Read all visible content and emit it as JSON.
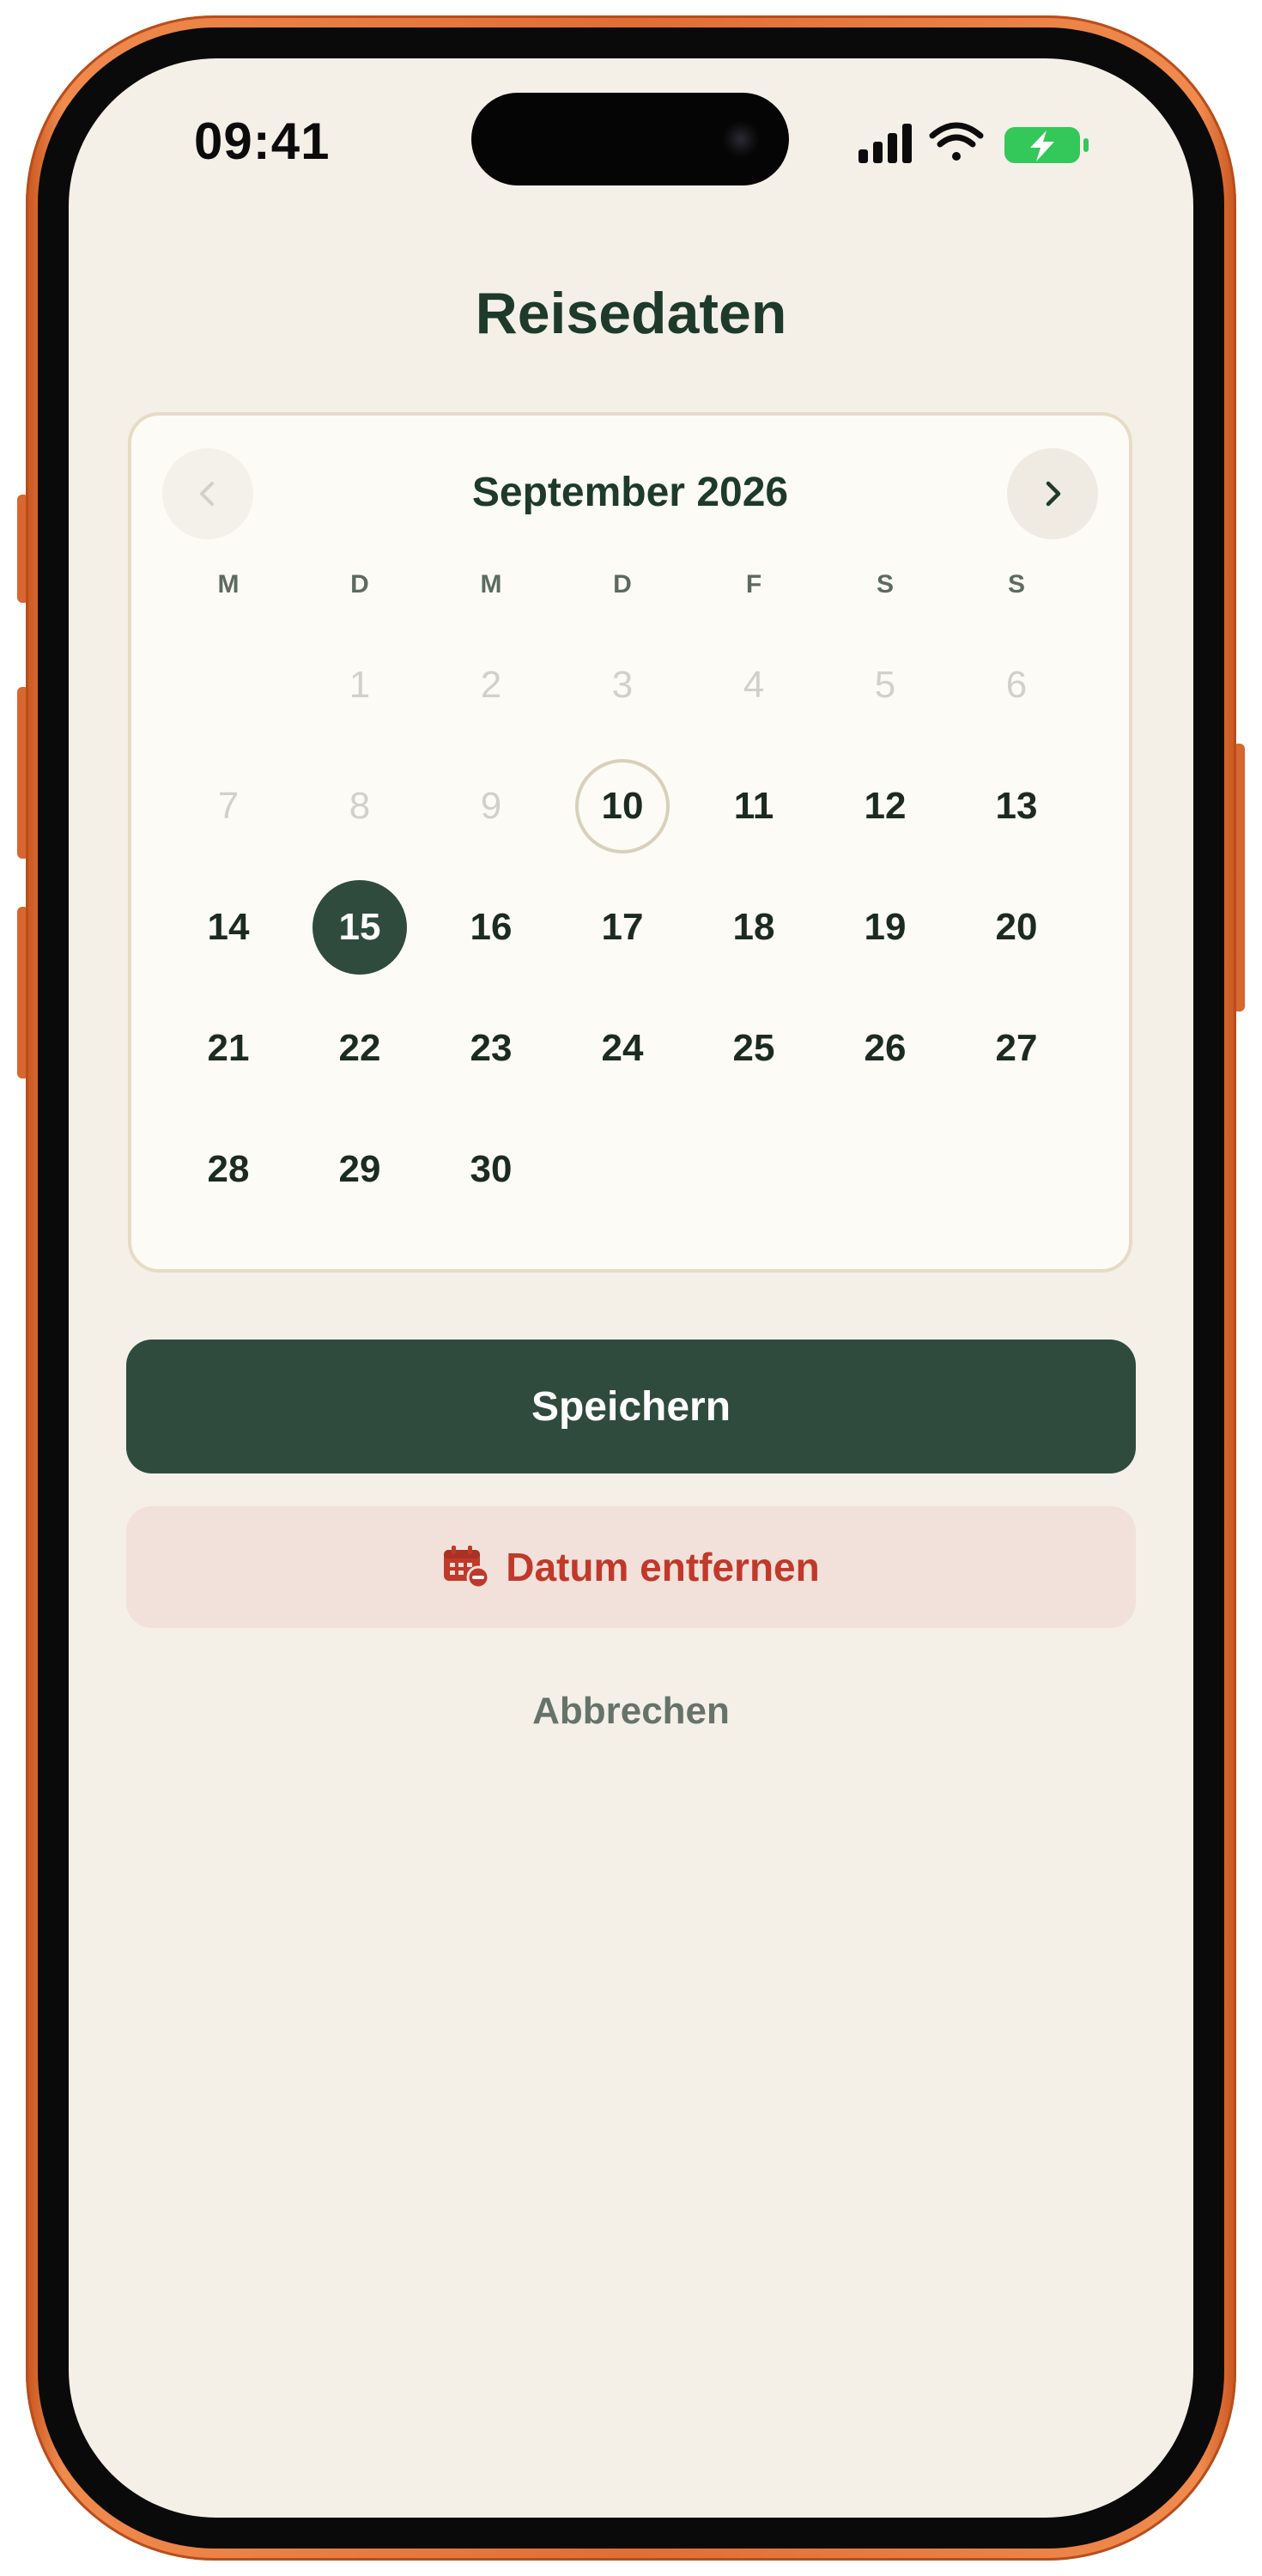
{
  "status_bar": {
    "time": "09:41",
    "icons": [
      "cellular-signal-icon",
      "wifi-icon",
      "battery-charging-icon"
    ],
    "battery_color": "#34c759"
  },
  "header": {
    "title": "Reisedaten"
  },
  "calendar": {
    "month_label": "September 2026",
    "prev_icon": "chevron-left-icon",
    "next_icon": "chevron-right-icon",
    "weekdays": [
      "M",
      "D",
      "M",
      "D",
      "F",
      "S",
      "S"
    ],
    "first_weekday_offset": 1,
    "days": [
      {
        "label": "1",
        "state": "disabled"
      },
      {
        "label": "2",
        "state": "disabled"
      },
      {
        "label": "3",
        "state": "disabled"
      },
      {
        "label": "4",
        "state": "disabled"
      },
      {
        "label": "5",
        "state": "disabled"
      },
      {
        "label": "6",
        "state": "disabled"
      },
      {
        "label": "7",
        "state": "disabled"
      },
      {
        "label": "8",
        "state": "disabled"
      },
      {
        "label": "9",
        "state": "disabled"
      },
      {
        "label": "10",
        "state": "today"
      },
      {
        "label": "11",
        "state": "normal"
      },
      {
        "label": "12",
        "state": "normal"
      },
      {
        "label": "13",
        "state": "normal"
      },
      {
        "label": "14",
        "state": "normal"
      },
      {
        "label": "15",
        "state": "selected"
      },
      {
        "label": "16",
        "state": "normal"
      },
      {
        "label": "17",
        "state": "normal"
      },
      {
        "label": "18",
        "state": "normal"
      },
      {
        "label": "19",
        "state": "normal"
      },
      {
        "label": "20",
        "state": "normal"
      },
      {
        "label": "21",
        "state": "normal"
      },
      {
        "label": "22",
        "state": "normal"
      },
      {
        "label": "23",
        "state": "normal"
      },
      {
        "label": "24",
        "state": "normal"
      },
      {
        "label": "25",
        "state": "normal"
      },
      {
        "label": "26",
        "state": "normal"
      },
      {
        "label": "27",
        "state": "normal"
      },
      {
        "label": "28",
        "state": "normal"
      },
      {
        "label": "29",
        "state": "normal"
      },
      {
        "label": "30",
        "state": "normal"
      }
    ]
  },
  "actions": {
    "save_label": "Speichern",
    "remove_label": "Datum entfernen",
    "remove_icon": "calendar-remove-icon",
    "cancel_label": "Abbrechen"
  },
  "colors": {
    "primary": "#2f4b3e",
    "danger": "#c0392b",
    "danger_bg": "#f1e1da",
    "background": "#f4f0e8",
    "device_frame": "#e06e35"
  }
}
